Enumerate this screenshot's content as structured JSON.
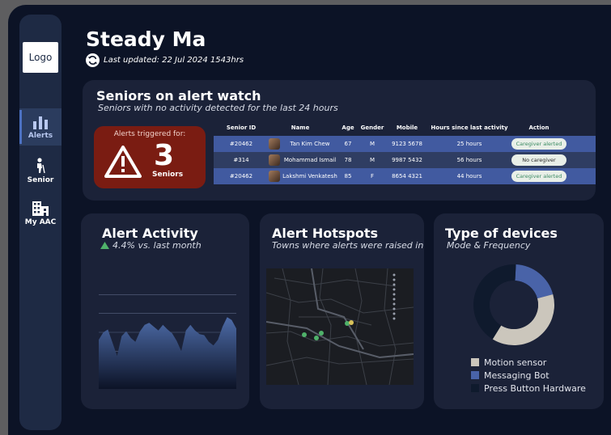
{
  "header": {
    "title": "Steady Ma",
    "last_updated": "Last updated: 22 Jul 2024 1543hrs"
  },
  "sidebar": {
    "logo": "Logo",
    "items": [
      {
        "label": "Alerts",
        "icon": "bar-chart-icon",
        "active": true
      },
      {
        "label": "Senior",
        "icon": "person-cane-icon",
        "active": false
      },
      {
        "label": "My AAC",
        "icon": "building-icon",
        "active": false
      }
    ]
  },
  "watch": {
    "title": "Seniors on alert watch",
    "subtitle": "Seniors with no activity detected for the last 24 hours",
    "alert_label": "Alerts triggered for:",
    "alert_count": "3",
    "alert_unit": "Seniors",
    "columns": [
      "Senior ID",
      "Name",
      "Age",
      "Gender",
      "Mobile",
      "Hours since last activity",
      "Action"
    ],
    "rows": [
      {
        "id": "#20462",
        "name": "Tan Kim Chew",
        "age": "67",
        "gender": "M",
        "mobile": "9123 5678",
        "hours": "25 hours",
        "action": "Caregiver alerted"
      },
      {
        "id": "#314",
        "name": "Mohammad Ismail",
        "age": "78",
        "gender": "M",
        "mobile": "9987 5432",
        "hours": "56 hours",
        "action": "No caregiver"
      },
      {
        "id": "#20462",
        "name": "Lakshmi Venkatesh",
        "age": "85",
        "gender": "F",
        "mobile": "8654 4321",
        "hours": "44 hours",
        "action": "Caregiver alerted"
      }
    ]
  },
  "activity": {
    "title": "Alert Activity",
    "change": "4.4% vs. last month"
  },
  "hotspots": {
    "title": "Alert Hotspots",
    "subtitle": "Towns where alerts were raised in"
  },
  "devices": {
    "title": "Type of devices",
    "subtitle": "Mode & Frequency"
  },
  "colors": {
    "accent": "#4c71c2",
    "alert_red": "#7a1c12",
    "positive_green": "#4fb26a"
  },
  "chart_data": [
    {
      "type": "area",
      "title": "Alert Activity",
      "x": [
        0,
        1,
        2,
        3,
        4,
        5,
        6,
        7,
        8,
        9,
        10,
        11,
        12,
        13,
        14,
        15,
        16,
        17,
        18,
        19,
        20,
        21,
        22,
        23,
        24,
        25,
        26,
        27,
        28,
        29,
        30
      ],
      "values": [
        5.2,
        6.0,
        6.3,
        4.9,
        3.5,
        5.6,
        6.1,
        5.4,
        5.0,
        6.1,
        6.8,
        7.0,
        6.6,
        6.2,
        6.8,
        6.3,
        5.9,
        5.1,
        4.0,
        6.2,
        6.8,
        6.2,
        5.8,
        5.7,
        5.0,
        4.6,
        5.2,
        6.6,
        7.6,
        7.3,
        6.4
      ],
      "ylim": [
        0,
        12
      ],
      "grid": true
    },
    {
      "type": "pie",
      "title": "Type of devices",
      "series": [
        {
          "name": "Motion sensor",
          "value": 38,
          "color": "#cbc6bc"
        },
        {
          "name": "Messaging Bot",
          "value": 20,
          "color": "#4963a8"
        },
        {
          "name": "Press Button Hardware",
          "value": 42,
          "color": "#0f1a2d"
        }
      ],
      "legend": "bottom"
    }
  ]
}
